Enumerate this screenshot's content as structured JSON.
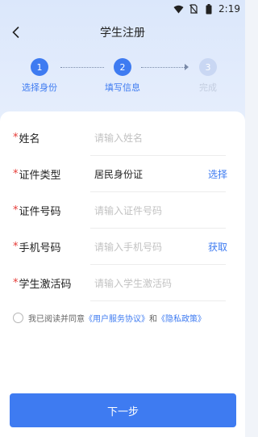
{
  "status_bar": {
    "time": "2:19",
    "icons": [
      "wifi-icon",
      "no-sim-icon",
      "battery-icon"
    ]
  },
  "header": {
    "title": "学生注册",
    "back_icon": "chevron-left-icon"
  },
  "stepper": {
    "steps": [
      {
        "number": "1",
        "label": "选择身份",
        "state": "done"
      },
      {
        "number": "2",
        "label": "填写信息",
        "state": "active"
      },
      {
        "number": "3",
        "label": "完成",
        "state": "pending"
      }
    ]
  },
  "form": {
    "required_mark": "*",
    "fields": [
      {
        "label": "姓名",
        "placeholder": "请输入姓名",
        "value": ""
      },
      {
        "label": "证件类型",
        "value": "居民身份证",
        "action": "选择"
      },
      {
        "label": "证件号码",
        "placeholder": "请输入证件号码",
        "value": ""
      },
      {
        "label": "手机号码",
        "placeholder": "请输入手机号码",
        "value": "",
        "action": "获取"
      },
      {
        "label": "学生激活码",
        "placeholder": "请输入学生激活码",
        "value": ""
      }
    ]
  },
  "agreement": {
    "prefix": "我已阅读并同意",
    "user_agreement": "《用户服务协议》",
    "conjunction": "和",
    "privacy_policy": "《隐私政策》",
    "checked": false
  },
  "footer": {
    "next_label": "下一步"
  },
  "colors": {
    "accent": "#3e7bf1",
    "required": "#e53935",
    "header_bg": "#dbe7fb"
  }
}
